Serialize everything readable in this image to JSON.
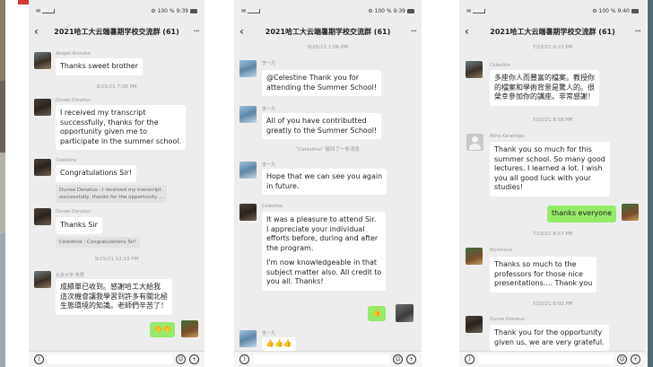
{
  "panels": [
    {
      "status_left": "✉",
      "status_right": "⚙ 100 % 9:39",
      "title": "2021哈工大云端暑期学校交流群 (61)",
      "messages": [
        {
          "sender": "Abigail Amooko",
          "lines": [
            "Thanks sweet brother"
          ]
        },
        {
          "timestamp": "9/25/21 7:08 PM"
        },
        {
          "sender": "Dunee Donatus",
          "lines": [
            "I received my transcript",
            "successfully, thanks for the",
            "opportunity given me to",
            "participate in the summer school."
          ]
        },
        {
          "sender": "Celestine",
          "lines": [
            "Congratulations Sir!"
          ],
          "quote": [
            "Dunee Donatus : I received my transcript",
            "successfully, thanks for the opportunity ..."
          ]
        },
        {
          "sender": "Dunee Donatus",
          "lines": [
            "Thanks Sir"
          ],
          "quote": [
            "Celestine : Congratulations Sir!"
          ]
        },
        {
          "timestamp": "9/25/21 12:13 PM"
        },
        {
          "sender": "北京大学-朱慧",
          "lines": [
            "成績單已收到。感謝哈工大給我",
            "這次機會讓我學習到許多有關北極",
            "生態環境的知識。老師們辛苦了！"
          ]
        },
        {
          "self_sticker": "👏👏"
        }
      ]
    },
    {
      "status_left": "✉",
      "status_right": "⚙ 100 % 9:39",
      "title": "2021哈工大云端暑期学校交流群 (61)",
      "messages": [
        {
          "timestamp": "9/25/21 1:06 PM"
        },
        {
          "sender": "李一凡",
          "lines": [
            "@Celestine Thank you for",
            "attending the Summer School!"
          ]
        },
        {
          "sender": "李一凡",
          "lines": [
            "All of you have contributted",
            "greatly to the Summer School!"
          ]
        },
        {
          "sysnote": "\"Celestine\" 撤回了一条消息"
        },
        {
          "sender": "李一凡",
          "lines": [
            "Hope that we can see you again",
            "in future."
          ]
        },
        {
          "sender": "Celestine",
          "lines": [
            "It was a pleasure to attend Sir.",
            "I appreciate your individual",
            "efforts before, during and after",
            "the program.",
            "",
            "I'm now knowledgeable in that",
            "subject matter also. All credit to",
            "you all. Thanks!"
          ]
        },
        {
          "self_sticker": "👍"
        },
        {
          "sender": "李一凡",
          "lines": [
            "👍👍👍"
          ]
        }
      ]
    },
    {
      "status_left": "✉",
      "status_right": "⚙ 100 % 9:40",
      "title": "2021哈工大云端暑期学校交流群 (61)",
      "messages": [
        {
          "timestamp": "7/23/21 6:23 PM"
        },
        {
          "sender": "Celestine",
          "lines": [
            "多座你人而豐富的檔案。教授你",
            "的檔案和學術背景是驚人的。很",
            "榮幸參加你的講座。非常感謝！"
          ]
        },
        {
          "timestamp": "7/23/21 8:58 PM"
        },
        {
          "sender": "Alina Karaboga",
          "lines": [
            "Thank you so much for this",
            "summer school. So many good",
            "lectures. I learned a lot. I wish",
            "you all good luck with your",
            "studies!"
          ]
        },
        {
          "self_lines": [
            "thanks everyone"
          ]
        },
        {
          "timestamp": "7/23/21 8:57 PM"
        },
        {
          "sender": "Richmond",
          "lines": [
            "Thanks so much to the",
            "professors for those nice",
            "presentations.... Thank you"
          ]
        },
        {
          "timestamp": "7/23/21 9:02 PM"
        },
        {
          "sender": "Dunee Donatus",
          "lines": [
            "Thank you for the opportunity",
            "given us, we are very grateful."
          ]
        }
      ]
    }
  ]
}
